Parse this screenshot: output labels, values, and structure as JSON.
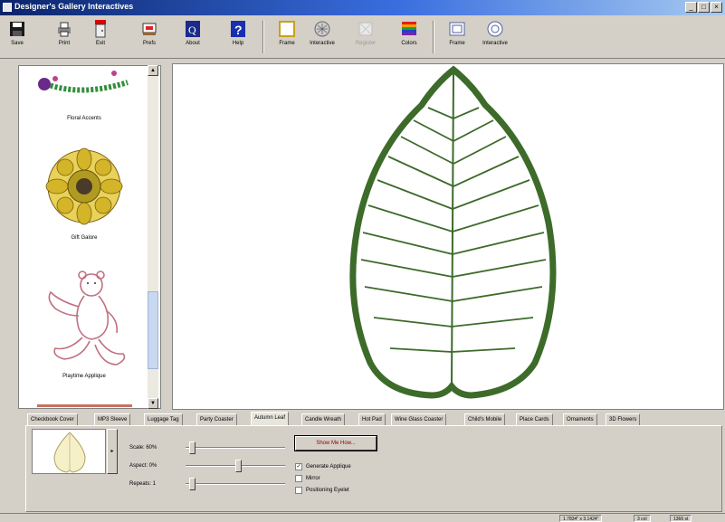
{
  "window": {
    "title": "Designer's Gallery Interactives"
  },
  "toolbar": {
    "buttons": [
      {
        "label": "Save",
        "icon": "floppy-disk-icon"
      },
      {
        "label": "Print",
        "icon": "printer-icon"
      },
      {
        "label": "Exit",
        "icon": "exit-door-icon"
      },
      {
        "label": "Prefs",
        "icon": "preferences-icon"
      },
      {
        "label": "About",
        "icon": "about-icon"
      },
      {
        "label": "Help",
        "icon": "help-icon"
      },
      {
        "label": "Frame",
        "icon": "frame-icon"
      },
      {
        "label": "Interactive",
        "icon": "interactive-icon"
      },
      {
        "label": "Register",
        "icon": "register-icon",
        "disabled": true
      },
      {
        "label": "Colors",
        "icon": "colors-icon"
      },
      {
        "label": "Frame",
        "icon": "frame-view-icon"
      },
      {
        "label": "Interactive",
        "icon": "interactive-view-icon"
      }
    ]
  },
  "gallery": {
    "items": [
      {
        "label": "Floral Accents"
      },
      {
        "label": "Gift Galore"
      },
      {
        "label": "Playtime Applique"
      }
    ]
  },
  "tabs": [
    {
      "label": "Checkbook Cover"
    },
    {
      "label": "MP3 Sleeve"
    },
    {
      "label": "Luggage Tag"
    },
    {
      "label": "Party Coaster"
    },
    {
      "label": "Autumn Leaf",
      "active": true
    },
    {
      "label": "Candle Wreath"
    },
    {
      "label": "Hot Pad"
    },
    {
      "label": "Wine Glass Coaster"
    },
    {
      "label": "Child's Mobile"
    },
    {
      "label": "Place Cards"
    },
    {
      "label": "Ornaments"
    },
    {
      "label": "3D Flowers"
    }
  ],
  "controls": {
    "scale_label": "Scale: 60%",
    "aspect_label": "Aspect: 0%",
    "repeats_label": "Repeats: 1",
    "show_button": "Show Me How...",
    "checkboxes": [
      {
        "label": "Generate Applique",
        "checked": true
      },
      {
        "label": "Mirror",
        "checked": false
      },
      {
        "label": "Positioning Eyelet",
        "checked": false
      }
    ]
  },
  "status": {
    "size": "1.7834\" x 3.1424\"",
    "colors": "3 col",
    "stitches": "1366 st"
  },
  "colors": {
    "leaf_green": "#3d6b2a",
    "title_blue": "#0a246a"
  }
}
